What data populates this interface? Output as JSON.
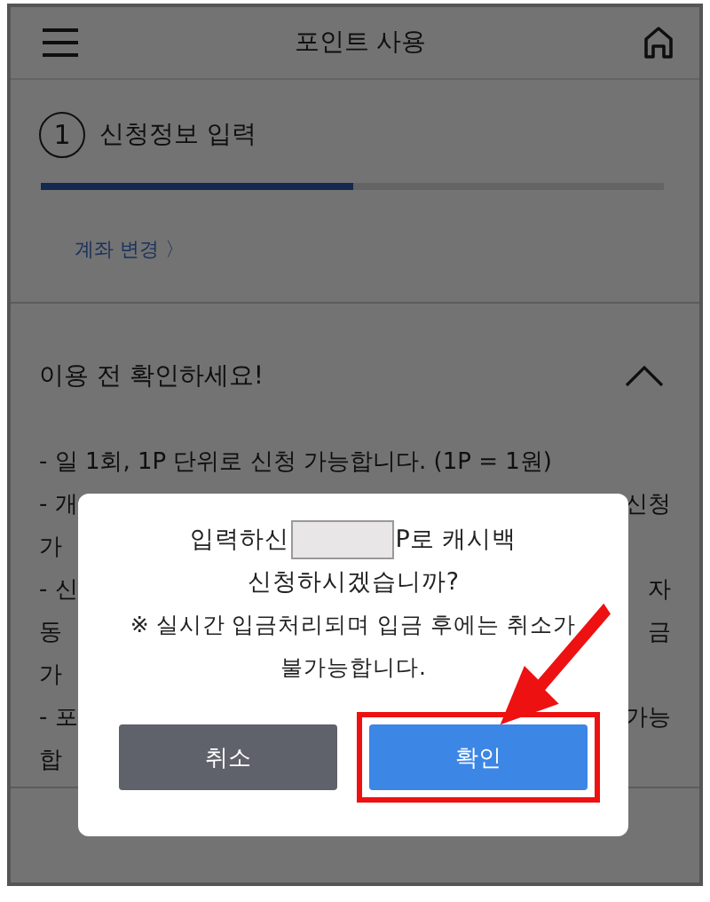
{
  "header": {
    "title": "포인트 사용"
  },
  "step": {
    "number": "1",
    "label": "신청정보 입력",
    "level": 0.5
  },
  "account_link": {
    "label": "계좌 변경",
    "arrow": "〉"
  },
  "notice": {
    "title": "이용 전 확인하세요!",
    "expanded": true,
    "lines": [
      {
        "left": "- 일 1회, 1P 단위로 신청 가능합니다. (1P = 1원)"
      },
      {
        "left": "- 개",
        "right": "신청"
      },
      {
        "left": "가"
      },
      {
        "left": "- 신",
        "right": "자"
      },
      {
        "left": "동",
        "right": "금"
      },
      {
        "left": "가"
      },
      {
        "left": "- 포",
        "right": "가능"
      },
      {
        "left": "합"
      }
    ]
  },
  "dialog": {
    "message_before": "입력하신",
    "message_after": "P로 캐시백",
    "message_line2": "신청하시겠습니까?",
    "warning": "※ 실시간 입금처리되며 입금 후에는 취소가 불가능합니다.",
    "buttons": [
      {
        "label": "취소",
        "kind": "cancel",
        "highlighted": false
      },
      {
        "label": "확인",
        "kind": "confirm",
        "highlighted": true
      }
    ]
  }
}
